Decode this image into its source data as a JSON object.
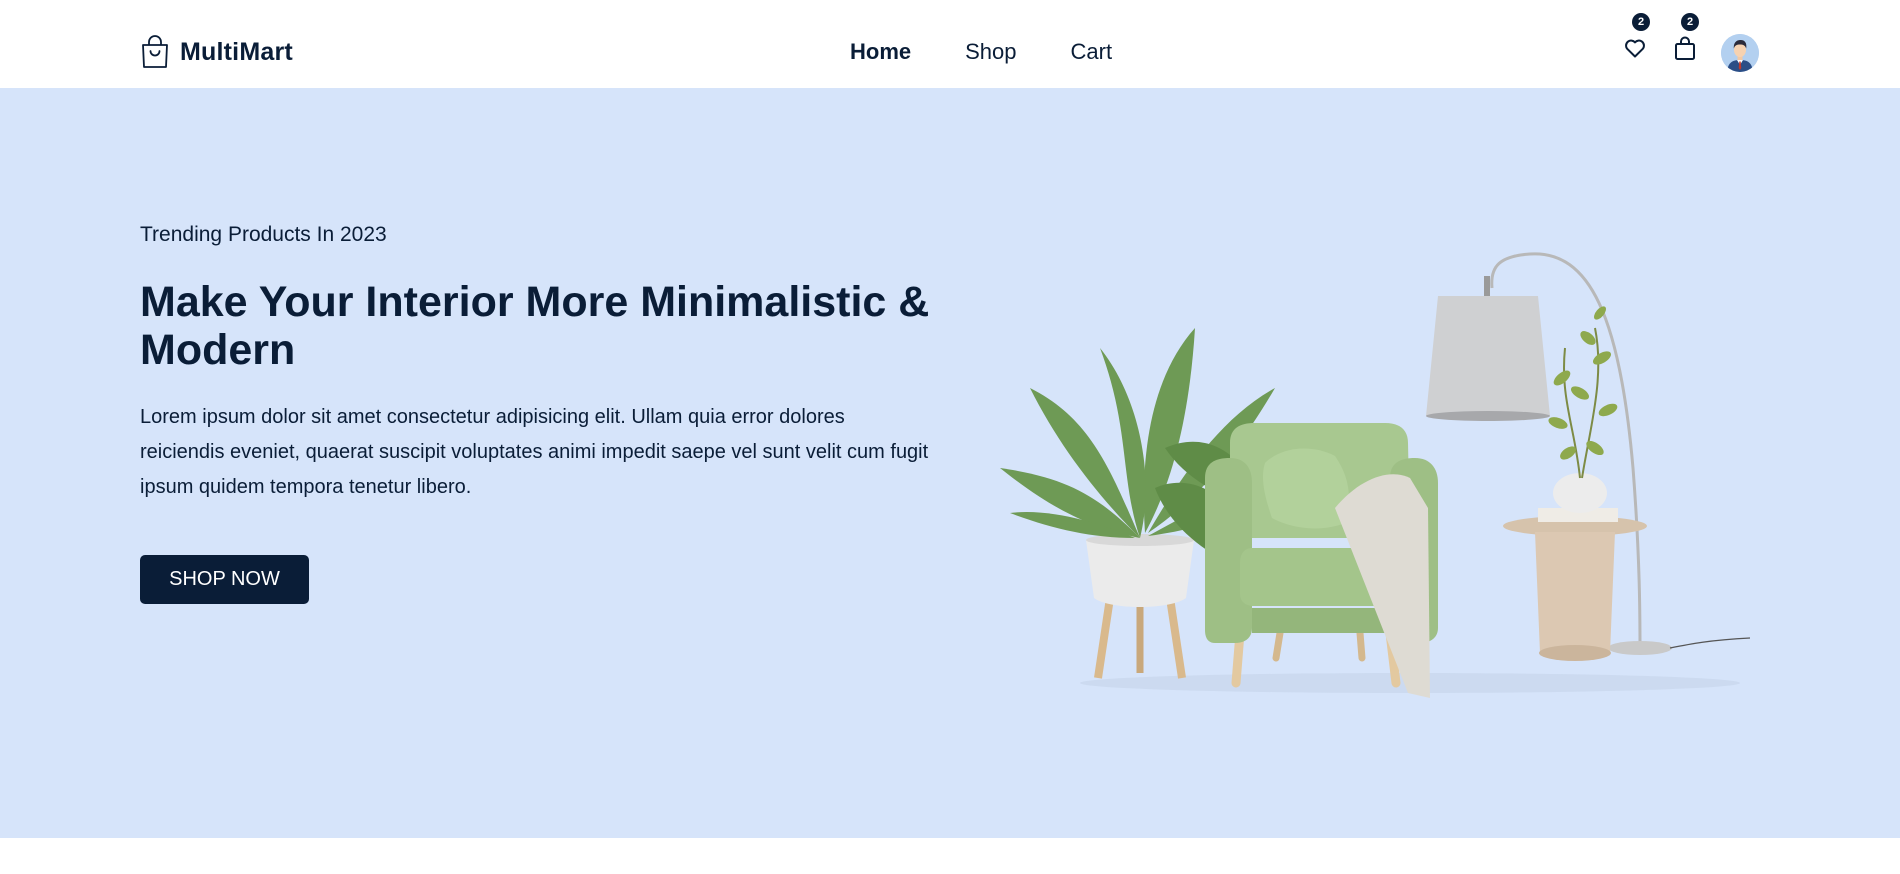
{
  "header": {
    "brand": "MultiMart",
    "logo_icon": "shopping-bag-icon",
    "nav": [
      {
        "label": "Home",
        "active": true
      },
      {
        "label": "Shop",
        "active": false
      },
      {
        "label": "Cart",
        "active": false
      }
    ],
    "wishlist": {
      "icon": "heart-icon",
      "count": "2"
    },
    "cart": {
      "icon": "bag-icon",
      "count": "2"
    },
    "avatar": "user-avatar"
  },
  "hero": {
    "subtitle": "Trending Products In 2023",
    "title": "Make Your Interior More Minimalistic & Modern",
    "description": "Lorem ipsum dolor sit amet consectetur adipisicing elit. Ullam quia error dolores reiciendis eveniet, quaerat suscipit voluptates animi impedit saepe vel sunt velit cum fugit ipsum quidem tempora tenetur libero.",
    "cta_label": "SHOP NOW",
    "image": "armchair-plant-lamp-illustration"
  },
  "colors": {
    "primary": "#0a1d37",
    "hero_bg": "#d6e4fa",
    "header_bg": "#ffffff"
  }
}
